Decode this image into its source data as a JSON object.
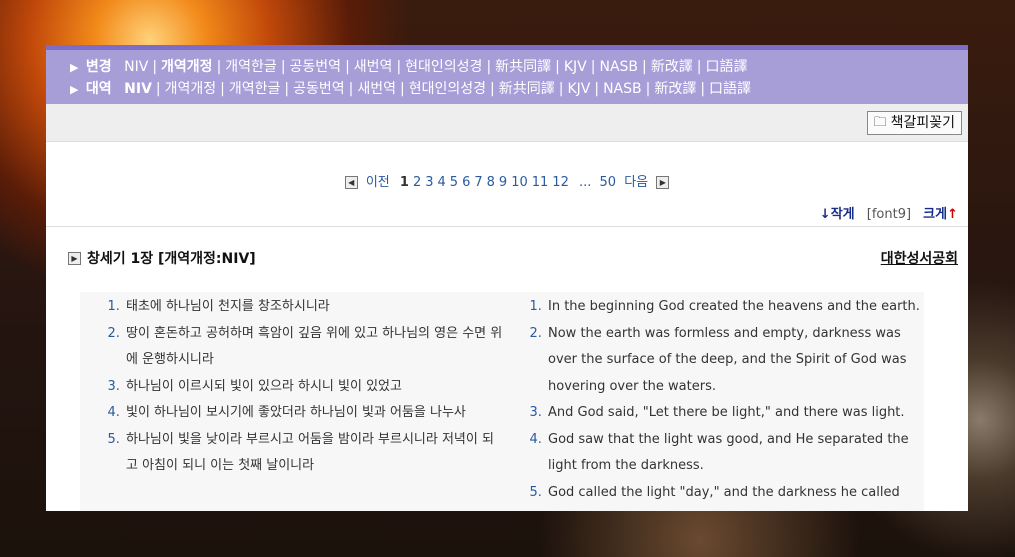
{
  "nav": {
    "change": {
      "label": "변경",
      "options": [
        "NIV",
        "개역개정",
        "개역한글",
        "공동번역",
        "새번역",
        "현대인의성경",
        "新共同譯",
        "KJV",
        "NASB",
        "新改譯",
        "口語譯"
      ],
      "active": "개역개정"
    },
    "compare": {
      "label": "대역",
      "options": [
        "NIV",
        "개역개정",
        "개역한글",
        "공동번역",
        "새번역",
        "현대인의성경",
        "新共同譯",
        "KJV",
        "NASB",
        "新改譯",
        "口語譯"
      ],
      "active": "NIV"
    }
  },
  "toolbar": {
    "bookmark_label": "책갈피꽂기"
  },
  "pager": {
    "prev": "이전",
    "pages": [
      "1",
      "2",
      "3",
      "4",
      "5",
      "6",
      "7",
      "8",
      "9",
      "10",
      "11",
      "12"
    ],
    "ellipsis": "...",
    "last": "50",
    "next": "다음",
    "current": "1"
  },
  "font_control": {
    "smaller": "작게",
    "current": "[font9]",
    "bigger": "크게"
  },
  "chapter": {
    "title": "창세기 1장 [개역개정:NIV]",
    "publisher": "대한성서공회"
  },
  "verses_ko": [
    "태초에 하나님이 천지를 창조하시니라",
    "땅이 혼돈하고 공허하며 흑암이 깊음 위에 있고 하나님의 영은 수면 위에 운행하시니라",
    "하나님이 이르시되 빛이 있으라 하시니 빛이 있었고",
    "빛이 하나님이 보시기에 좋았더라 하나님이 빛과 어둠을 나누사",
    "하나님이 빛을 낮이라 부르시고 어둠을 밤이라 부르시니라 저녁이 되고 아침이 되니 이는 첫째 날이니라"
  ],
  "verses_en": [
    "In the beginning God created the heavens and the earth.",
    "Now the earth was formless and empty, darkness was over the surface of the deep, and the Spirit of God was hovering over the waters.",
    "And God said, \"Let there be light,\" and there was light.",
    "God saw that the light was good, and He separated the light from the darkness.",
    "God called the light \"day,\" and the darkness he called"
  ]
}
